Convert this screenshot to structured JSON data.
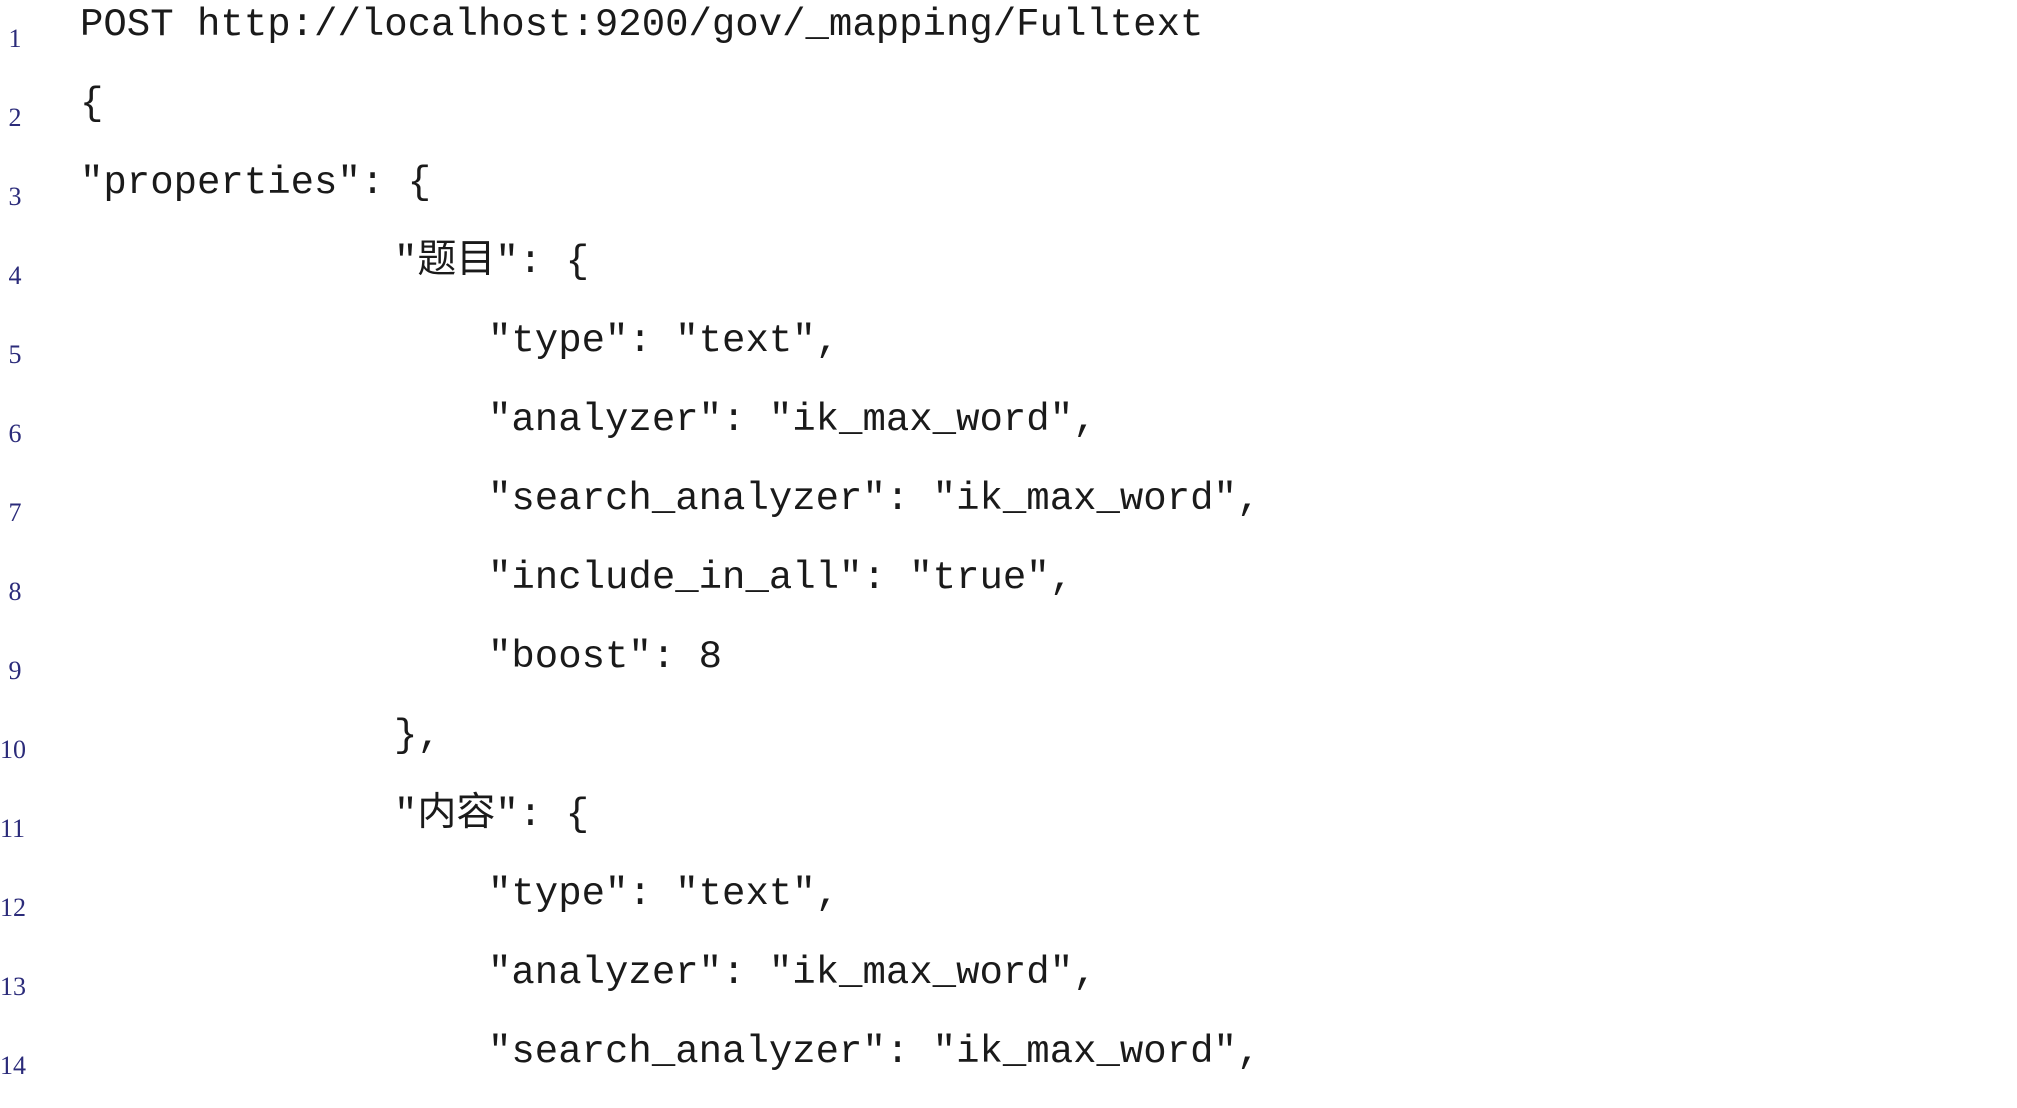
{
  "code": {
    "lines": [
      {
        "number": "1",
        "text": "POST http://localhost:9200/gov/_mapping/Fulltext"
      },
      {
        "number": "2",
        "text": "{"
      },
      {
        "number": "3",
        "text": "\"properties\": {"
      },
      {
        "number": "4",
        "text": "\"题目\": {"
      },
      {
        "number": "5",
        "text": "\"type\": \"text\","
      },
      {
        "number": "6",
        "text": "\"analyzer\": \"ik_max_word\","
      },
      {
        "number": "7",
        "text": "\"search_analyzer\": \"ik_max_word\","
      },
      {
        "number": "8",
        "text": "\"include_in_all\": \"true\","
      },
      {
        "number": "9",
        "text": "\"boost\": 8"
      },
      {
        "number": "10",
        "text": "},"
      },
      {
        "number": "11",
        "text": "\"内容\": {"
      },
      {
        "number": "12",
        "text": "\"type\": \"text\","
      },
      {
        "number": "13",
        "text": "\"analyzer\": \"ik_max_word\","
      },
      {
        "number": "14",
        "text": "\"search_analyzer\": \"ik_max_word\","
      }
    ]
  }
}
